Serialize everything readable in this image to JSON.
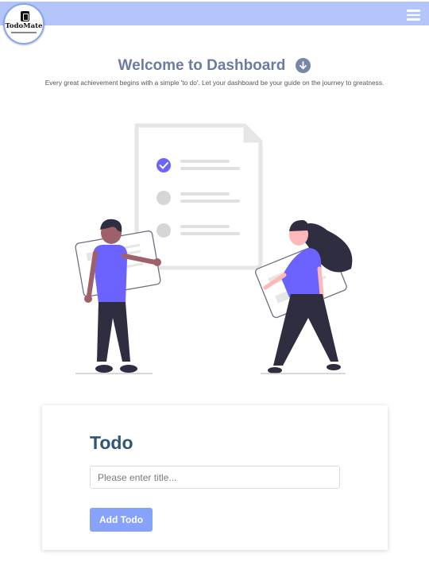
{
  "header": {
    "logo_text": "TodoMate",
    "menu_icon": "hamburger-menu-icon"
  },
  "welcome": {
    "title": "Welcome to Dashboard",
    "title_icon": "arrow-down-circle-icon",
    "subtitle": "Every great achievement begins with a simple 'to do'. Let your dashboard be your guide on the journey to greatness."
  },
  "illustration": {
    "name": "people-with-checklist-illustration",
    "accent_color": "#6c63ff"
  },
  "todo_form": {
    "title": "Todo",
    "input_placeholder": "Please enter title...",
    "input_value": "",
    "submit_label": "Add Todo"
  },
  "colors": {
    "topbar": "#b3c5fa",
    "heading": "#6b7ba3",
    "card_title": "#2f5579",
    "button": "#87a2fb"
  }
}
